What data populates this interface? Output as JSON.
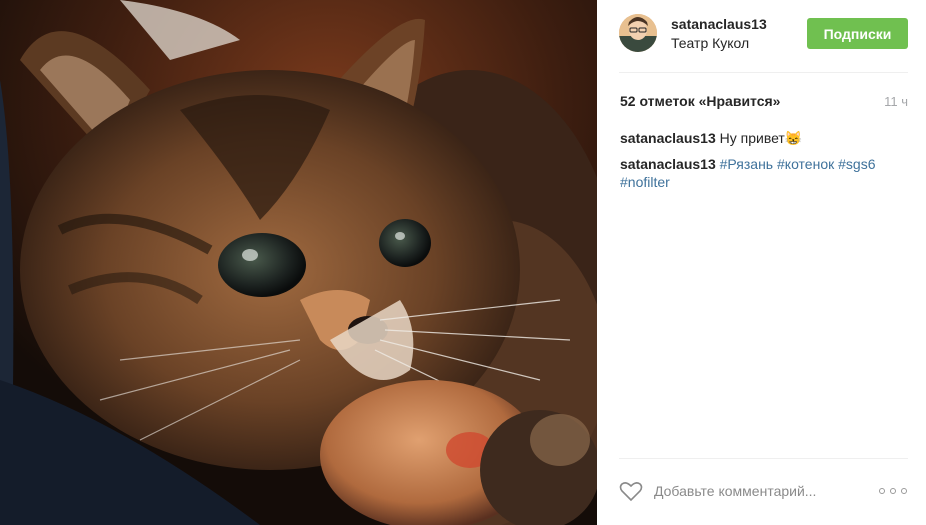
{
  "post": {
    "image": {
      "subject": "kitten-photo"
    },
    "owner": {
      "username": "satanaclaus13",
      "location": "Театр Кукол"
    },
    "follow_button_label": "Подписки",
    "likes_text": "52 отметок «Нравится»",
    "timestamp": "11 ч",
    "comments": [
      {
        "user": "satanaclaus13",
        "text": "Ну привет😸",
        "tags": []
      },
      {
        "user": "satanaclaus13",
        "text": "",
        "tags": [
          "#Рязань",
          "#котенок",
          "#sgs6",
          "#nofilter"
        ]
      }
    ],
    "comment_placeholder": "Добавьте комментарий...",
    "icons": {
      "like": "heart-icon",
      "more": "more-options-icon"
    },
    "colors": {
      "follow_button": "#70c050",
      "hashtag": "#3f729b",
      "timestamp": "#a5a7aa"
    }
  }
}
